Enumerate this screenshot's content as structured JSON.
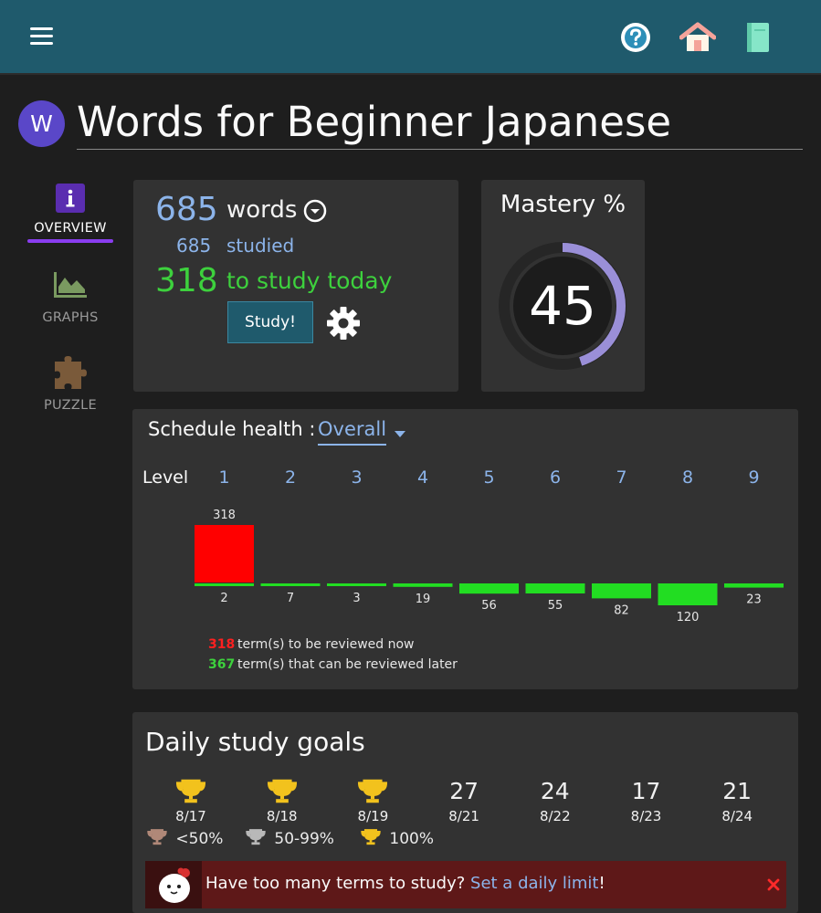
{
  "header": {
    "menu_icon": "hamburger-menu-icon",
    "help_icon": "help-circle-icon",
    "home_icon": "home-icon",
    "book_icon": "notebook-icon"
  },
  "set": {
    "avatar_letter": "W",
    "title": "Words for Beginner Japanese"
  },
  "sidebar": {
    "items": [
      {
        "label": "OVERVIEW",
        "icon": "info-icon",
        "active": true
      },
      {
        "label": "GRAPHS",
        "icon": "area-chart-icon",
        "active": false
      },
      {
        "label": "PUZZLE",
        "icon": "puzzle-piece-icon",
        "active": false
      }
    ]
  },
  "stats": {
    "word_count": "685",
    "words_label": "words",
    "studied_count": "685",
    "studied_label": "studied",
    "today_count": "318",
    "today_label": "to study today",
    "study_button": "Study!",
    "settings_icon": "gear-icon"
  },
  "mastery": {
    "title": "Mastery %",
    "value": 45,
    "value_text": "45",
    "ring_color": "#9a8fd8"
  },
  "schedule": {
    "title": "Schedule health :",
    "selector": "Overall",
    "level_label": "Level",
    "levels": [
      "1",
      "2",
      "3",
      "4",
      "5",
      "6",
      "7",
      "8",
      "9"
    ],
    "due_now_counts": [
      318,
      0,
      0,
      0,
      0,
      0,
      0,
      0,
      0
    ],
    "later_counts": [
      2,
      7,
      3,
      19,
      56,
      55,
      82,
      120,
      23
    ],
    "due_now_label_text": "318",
    "later_label_texts": [
      "2",
      "7",
      "3",
      "19",
      "56",
      "55",
      "82",
      "120",
      "23"
    ],
    "legend_now_count": "318",
    "legend_now_text": "term(s) to be reviewed now",
    "legend_later_count": "367",
    "legend_later_text": "term(s) that can be reviewed later",
    "colors": {
      "due": "#ff0000",
      "later": "#22dd22"
    }
  },
  "goals": {
    "title": "Daily study goals",
    "days": [
      {
        "value": "",
        "trophy": "gold",
        "date": "8/17"
      },
      {
        "value": "",
        "trophy": "gold",
        "date": "8/18"
      },
      {
        "value": "",
        "trophy": "gold",
        "date": "8/19"
      },
      {
        "value": "27",
        "trophy": "",
        "date": "8/21"
      },
      {
        "value": "24",
        "trophy": "",
        "date": "8/22"
      },
      {
        "value": "17",
        "trophy": "",
        "date": "8/23"
      },
      {
        "value": "21",
        "trophy": "",
        "date": "8/24"
      }
    ],
    "legend": [
      {
        "label": "<50%",
        "color": "#b08878"
      },
      {
        "label": "50-99%",
        "color": "#b8b8b8"
      },
      {
        "label": "100%",
        "color": "#f2c21d"
      }
    ],
    "banner_question": "Have too many terms to study?",
    "banner_link": "Set a daily limit",
    "banner_end": "!",
    "close_icon": "close-icon",
    "mascot_icon": "mascot-icon"
  }
}
